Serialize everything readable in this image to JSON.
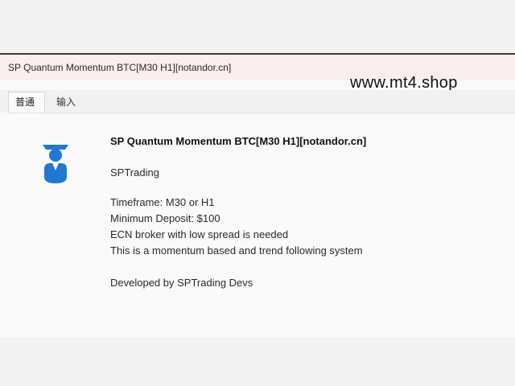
{
  "window": {
    "title": "SP Quantum Momentum BTC[M30 H1][notandor.cn]"
  },
  "watermark": "www.mt4.shop",
  "tabs": [
    {
      "label": "普通"
    },
    {
      "label": "输入"
    }
  ],
  "details": {
    "icon": "expert-advisor-icon",
    "name": "SP Quantum Momentum BTC[M30 H1][notandor.cn]",
    "author": "SPTrading",
    "lines": [
      "Timeframe: M30 or H1",
      "Minimum Deposit: $100",
      "ECN broker with low spread is needed",
      "This is a momentum based and trend following system"
    ],
    "footer": "Developed by SPTrading Devs"
  },
  "colors": {
    "icon_blue": "#1f78d1",
    "titlebar_bg": "#fbeeee"
  }
}
